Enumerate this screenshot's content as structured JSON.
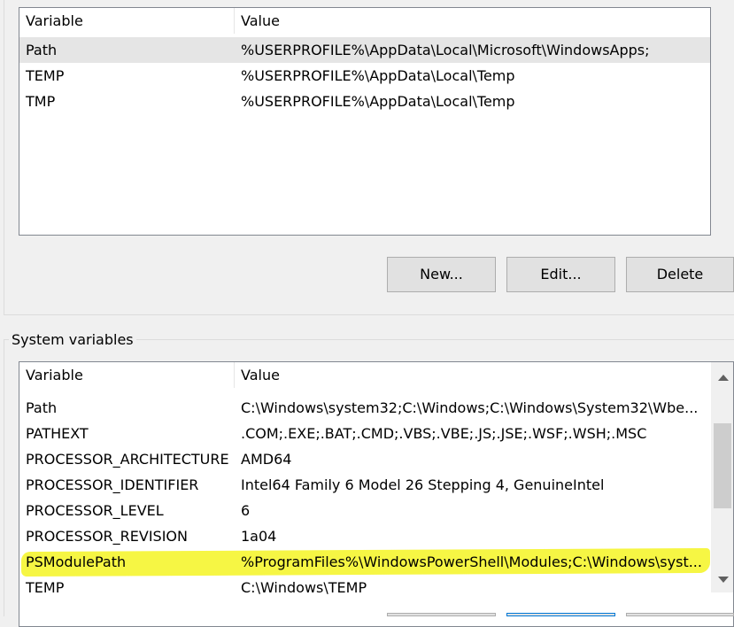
{
  "user_list": {
    "columns": [
      "Variable",
      "Value"
    ],
    "rows": [
      {
        "variable": "Path",
        "value": "%USERPROFILE%\\AppData\\Local\\Microsoft\\WindowsApps;"
      },
      {
        "variable": "TEMP",
        "value": "%USERPROFILE%\\AppData\\Local\\Temp"
      },
      {
        "variable": "TMP",
        "value": "%USERPROFILE%\\AppData\\Local\\Temp"
      }
    ]
  },
  "user_buttons": {
    "new": "New...",
    "edit": "Edit...",
    "delete": "Delete"
  },
  "system_group": {
    "label": "System variables"
  },
  "system_list": {
    "columns": [
      "Variable",
      "Value"
    ],
    "rows": [
      {
        "variable": "Path",
        "value": "C:\\Windows\\system32;C:\\Windows;C:\\Windows\\System32\\Wbe..."
      },
      {
        "variable": "PATHEXT",
        "value": ".COM;.EXE;.BAT;.CMD;.VBS;.VBE;.JS;.JSE;.WSF;.WSH;.MSC"
      },
      {
        "variable": "PROCESSOR_ARCHITECTURE",
        "value": "AMD64"
      },
      {
        "variable": "PROCESSOR_IDENTIFIER",
        "value": "Intel64 Family 6 Model 26 Stepping 4, GenuineIntel"
      },
      {
        "variable": "PROCESSOR_LEVEL",
        "value": "6"
      },
      {
        "variable": "PROCESSOR_REVISION",
        "value": "1a04"
      },
      {
        "variable": "PSModulePath",
        "value": "%ProgramFiles%\\WindowsPowerShell\\Modules;C:\\Windows\\syst..."
      },
      {
        "variable": "TEMP",
        "value": "C:\\Windows\\TEMP"
      }
    ]
  },
  "colors": {
    "highlight": "#f4f423",
    "selection": "#e5e5e5",
    "accent": "#0078d7"
  }
}
